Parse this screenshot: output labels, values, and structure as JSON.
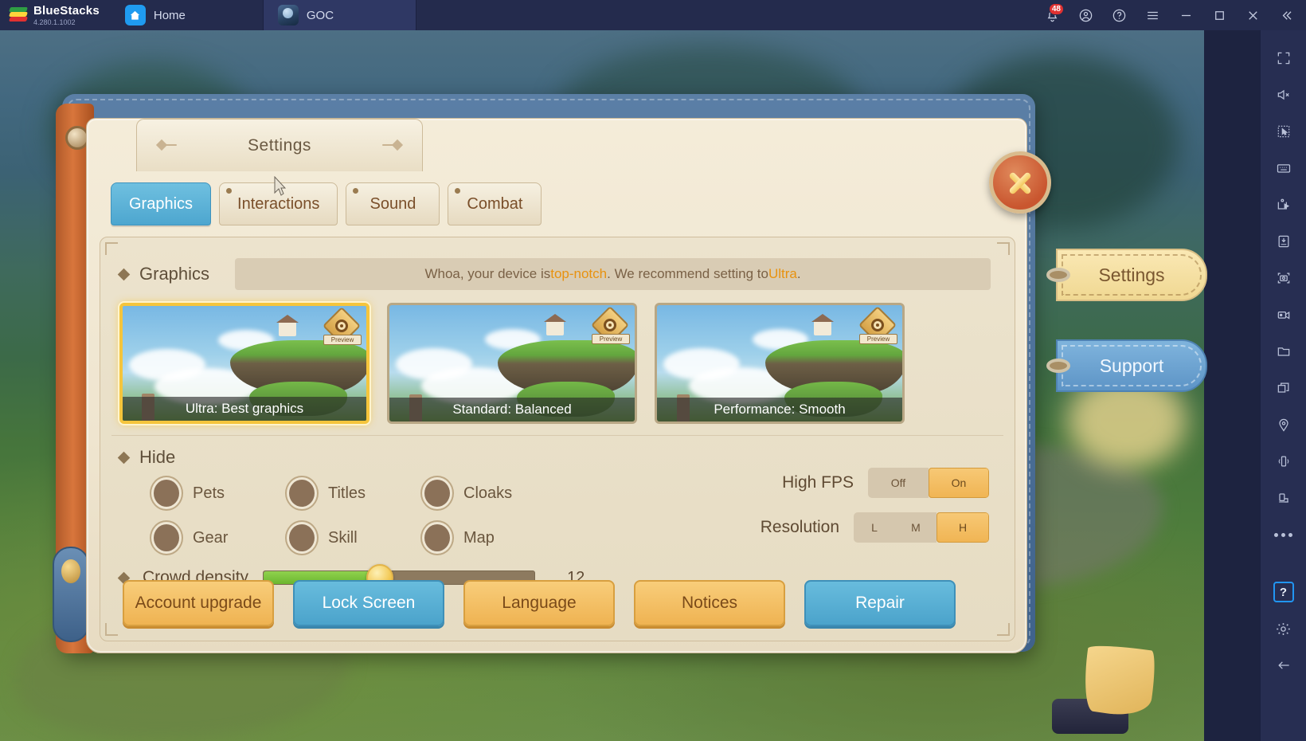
{
  "titlebar": {
    "brand_name": "BlueStacks",
    "version": "4.280.1.1002",
    "tabs": [
      {
        "label": "Home",
        "icon": "home-icon"
      },
      {
        "label": "GOC",
        "icon": "game-icon"
      }
    ],
    "notification_count": "48",
    "icons": [
      "bell-icon",
      "account-icon",
      "help-icon",
      "menu-icon",
      "minimize-icon",
      "maximize-icon",
      "close-icon",
      "collapse-icon"
    ]
  },
  "sidebar": {
    "items": [
      "fullscreen-icon",
      "mute-icon",
      "cursor-select-icon",
      "keyboard-controls-icon",
      "macro-icon",
      "install-apk-icon",
      "screenshot-icon",
      "record-icon",
      "folder-icon",
      "multi-instance-icon",
      "location-icon",
      "shake-icon",
      "rotate-icon",
      "more-icon"
    ],
    "help_label": "?",
    "bottom_items": [
      "settings-gear-icon",
      "back-arrow-icon"
    ]
  },
  "panel": {
    "title": "Settings",
    "tabs": [
      {
        "label": "Graphics",
        "active": true
      },
      {
        "label": "Interactions",
        "active": false
      },
      {
        "label": "Sound",
        "active": false
      },
      {
        "label": "Combat",
        "active": false
      }
    ],
    "close_label": "close"
  },
  "graphics": {
    "section_title": "Graphics",
    "recommendation": {
      "part1": "Whoa, your device is ",
      "highlight1": "top-notch",
      "part2": ". We recommend setting to ",
      "highlight2": "Ultra",
      "part3": "."
    },
    "preview_badge_text": "Preview",
    "cards": [
      {
        "label": "Ultra: Best graphics",
        "selected": true
      },
      {
        "label": "Standard: Balanced",
        "selected": false
      },
      {
        "label": "Performance: Smooth",
        "selected": false
      }
    ]
  },
  "hide": {
    "section_title": "Hide",
    "options": [
      {
        "label": "Pets",
        "checked": false
      },
      {
        "label": "Titles",
        "checked": false
      },
      {
        "label": "Cloaks",
        "checked": false
      },
      {
        "label": "Gear",
        "checked": false
      },
      {
        "label": "Skill",
        "checked": false
      },
      {
        "label": "Map",
        "checked": false
      }
    ]
  },
  "high_fps": {
    "label": "High FPS",
    "options": [
      "Off",
      "On"
    ],
    "selected": "On"
  },
  "resolution": {
    "label": "Resolution",
    "options": [
      "L",
      "M",
      "H"
    ],
    "selected": "H"
  },
  "crowd_density": {
    "label": "Crowd density",
    "value": "12",
    "percent": 43
  },
  "buttons": [
    {
      "label": "Account upgrade",
      "style": "orange"
    },
    {
      "label": "Lock Screen",
      "style": "blue"
    },
    {
      "label": "Language",
      "style": "orange"
    },
    {
      "label": "Notices",
      "style": "orange"
    },
    {
      "label": "Repair",
      "style": "blue"
    }
  ],
  "side_flags": [
    {
      "label": "Settings",
      "style": "settings"
    },
    {
      "label": "Support",
      "style": "support"
    }
  ],
  "colors": {
    "accent_orange": "#f0b453",
    "accent_blue": "#4ba3cb",
    "selected_gold": "#f5c53c",
    "slider_green": "#6cb62f",
    "highlight_text": "#e8920f",
    "titlebar_bg": "#242b4d"
  }
}
